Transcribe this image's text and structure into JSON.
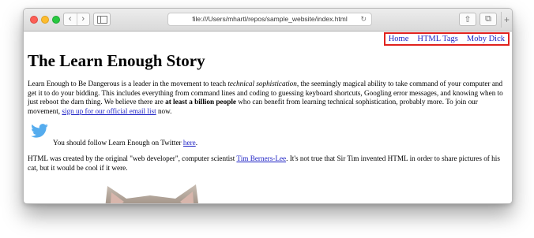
{
  "browser": {
    "url": "file:///Users/mhartl/repos/sample_website/index.html",
    "back_glyph": "‹",
    "forward_glyph": "›",
    "reload_glyph": "↻",
    "share_glyph": "⇧",
    "tabs_glyph": "⧉",
    "newtab_glyph": "+"
  },
  "nav": {
    "home": "Home",
    "html_tags": "HTML Tags",
    "moby_dick": "Moby Dick",
    "highlight_color": "#e0221e"
  },
  "page": {
    "title": "The Learn Enough Story",
    "p1_a": "Learn Enough to Be Dangerous is a leader in the movement to teach ",
    "p1_em": "technical sophistication",
    "p1_b": ", the seemingly magical ability to take command of your computer and get it to do your bidding. This includes everything from command lines and coding to guessing keyboard shortcuts, Googling error messages, and knowing when to just reboot the darn thing. We believe there are ",
    "p1_strong": "at least a billion people",
    "p1_c": " who can benefit from learning technical sophistication, probably more. To join our movement, ",
    "p1_link": "sign up for our official email list",
    "p1_d": " now.",
    "twitter_a": "You should follow Learn Enough on Twitter ",
    "twitter_link": "here",
    "twitter_b": ".",
    "p3_a": "HTML was created by the original \"web developer\", computer scientist ",
    "p3_link": "Tim Berners-Lee",
    "p3_b": ". It's not true that Sir Tim invented HTML in order to share pictures of his cat, but it would be cool if it were."
  },
  "icons": {
    "twitter": "twitter-bird-icon",
    "cat_image": "cat-image"
  },
  "colors": {
    "link": "#1b1fc4",
    "twitter_blue": "#55acee"
  }
}
